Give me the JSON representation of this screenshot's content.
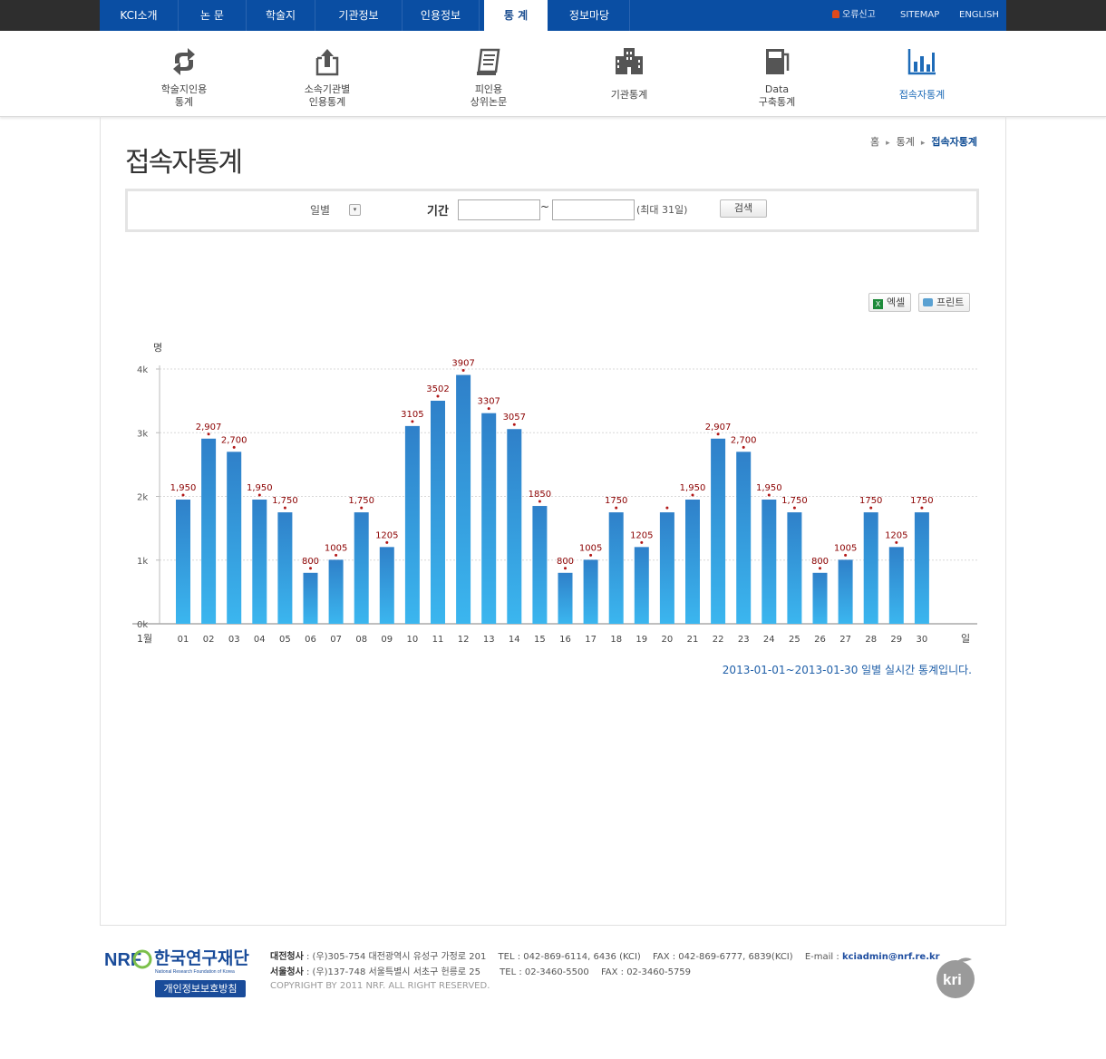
{
  "topnav": {
    "items": [
      "KCI소개",
      "논 문",
      "학술지",
      "기관정보",
      "인용정보",
      "통 계",
      "정보마당"
    ],
    "util": {
      "report": "오류신고",
      "sitemap": "SITEMAP",
      "english": "ENGLISH"
    }
  },
  "subnav": [
    {
      "line1": "학술지인용",
      "line2": "통계",
      "icon": "refresh-arrows-icon"
    },
    {
      "line1": "소속기관별",
      "line2": "인용통계",
      "icon": "upload-box-icon"
    },
    {
      "line1": "피인용",
      "line2": "상위논문",
      "icon": "scroll-document-icon"
    },
    {
      "line1": "기관통계",
      "line2": "",
      "icon": "building-icon"
    },
    {
      "line1": "Data",
      "line2": "구축통계",
      "icon": "server-icon"
    },
    {
      "line1": "접속자통계",
      "line2": "",
      "icon": "bar-chart-icon"
    }
  ],
  "page": {
    "title": "접속자통계"
  },
  "breadcrumb": {
    "home": "홈",
    "level1": "통계",
    "current": "접속자통계"
  },
  "search": {
    "period_type": "일별",
    "period_label": "기간",
    "start_value": "",
    "end_value": "",
    "tilde": "~",
    "max_note": "(최대 31일)",
    "button": "검색"
  },
  "actions": {
    "excel": "엑셀",
    "print": "프린트"
  },
  "colors": {
    "accent": "#0a4ea3",
    "bar_top": "#2f80c9",
    "bar_bottom": "#3bb6ef",
    "value_label": "#8b0000"
  },
  "chart_data": {
    "type": "bar",
    "ylabel": "명",
    "xlabel": "일",
    "month_label": "1월",
    "yticks": [
      "0k",
      "1k",
      "2k",
      "3k",
      "4k"
    ],
    "ylim": [
      0,
      4000
    ],
    "grid": true,
    "categories": [
      "01",
      "02",
      "03",
      "04",
      "05",
      "06",
      "07",
      "08",
      "09",
      "10",
      "11",
      "12",
      "13",
      "14",
      "15",
      "16",
      "17",
      "18",
      "19",
      "20",
      "21",
      "22",
      "23",
      "24",
      "25",
      "26",
      "27",
      "28",
      "29",
      "30"
    ],
    "values": [
      1950,
      2907,
      2700,
      1950,
      1750,
      800,
      1005,
      1750,
      1205,
      3105,
      3502,
      3907,
      3307,
      3057,
      1850,
      800,
      1005,
      1750,
      1205,
      1750,
      1950,
      2907,
      2700,
      1950,
      1750,
      800,
      1005,
      1750,
      1205,
      1750
    ],
    "labels": [
      "1,950",
      "2,907",
      "2,700",
      "1,950",
      "1,750",
      "800",
      "1005",
      "1,750",
      "1205",
      "3105",
      "3502",
      "3907",
      "3307",
      "3057",
      "1850",
      "800",
      "1005",
      "1750",
      "1205",
      "",
      "1,950",
      "2,907",
      "2,700",
      "1,950",
      "1,750",
      "800",
      "1005",
      "1750",
      "1205",
      "1750"
    ]
  },
  "note": "2013-01-01~2013-01-30 일별 실시간 통계입니다.",
  "footer": {
    "org_kr": "한국연구재단",
    "org_en": "National Research Foundation of Korea",
    "privacy": "개인정보보호방침",
    "daejeon_label": "대전청사",
    "daejeon_addr": ": (우)305-754 대전광역시 유성구 가정로 201",
    "daejeon_tel": "TEL : 042-869-6114, 6436 (KCI)",
    "daejeon_fax": "FAX : 042-869-6777, 6839(KCI)",
    "email_label": "E-mail :",
    "email": "kciadmin@nrf.re.kr",
    "seoul_label": "서울청사",
    "seoul_addr": ": (우)137-748 서울특별시 서초구 헌릉로 25",
    "seoul_tel": "TEL : 02-3460-5500",
    "seoul_fax": "FAX : 02-3460-5759",
    "copyright": "COPYRIGHT BY 2011 NRF. ALL RIGHT RESERVED."
  }
}
